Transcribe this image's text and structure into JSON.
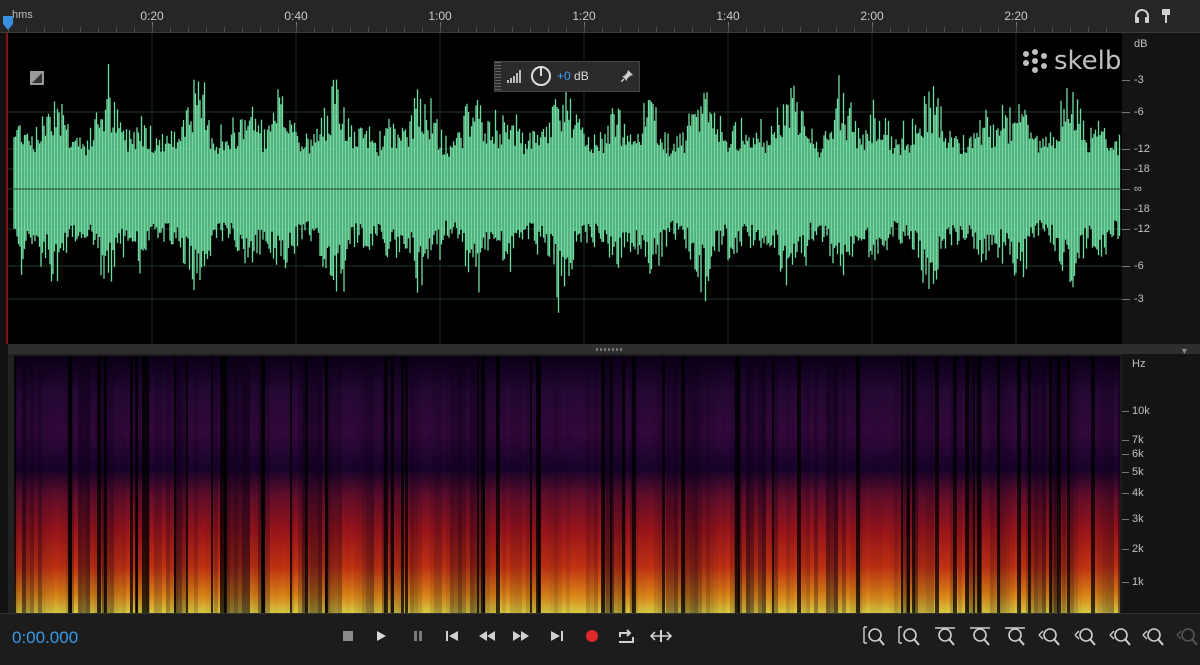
{
  "ruler": {
    "format_label": "hms",
    "time_labels": [
      "0:20",
      "0:40",
      "1:00",
      "1:20",
      "1:40",
      "2:00",
      "2:20"
    ]
  },
  "top_icons": [
    "headphones-icon",
    "pin-marker-icon"
  ],
  "waveform": {
    "color": "#6fdda2",
    "db_scale_label": "dB",
    "db_ticks": [
      "-3",
      "-6",
      "-12",
      "-18",
      "∞",
      "-18",
      "-12",
      "-6",
      "-3"
    ]
  },
  "hud": {
    "db_value": "+0",
    "db_unit": " dB",
    "icons": [
      "signal-bars-icon",
      "power-knob-icon",
      "pin-icon"
    ]
  },
  "spectral": {
    "hz_label": "Hz",
    "hz_ticks": [
      "10k",
      "7k",
      "6k",
      "5k",
      "4k",
      "3k",
      "2k",
      "1k"
    ]
  },
  "transport": {
    "timecode": "0:00.000",
    "timecode_color": "#3a9ae8",
    "record_color": "#e0282a",
    "buttons": [
      "stop",
      "play",
      "pause",
      "go-to-start",
      "rewind",
      "fast-forward",
      "go-to-end",
      "record",
      "loop",
      "skip-selection"
    ]
  },
  "zoom": {
    "buttons": [
      "zoom-in-amplitude",
      "zoom-out-amplitude",
      "zoom-in-time",
      "zoom-out-time",
      "zoom-full",
      "zoom-in-left",
      "zoom-in-right",
      "zoom-selection",
      "zoom-reset",
      "zoom-extra"
    ]
  },
  "watermark": {
    "text": "skelbiu.lt"
  }
}
